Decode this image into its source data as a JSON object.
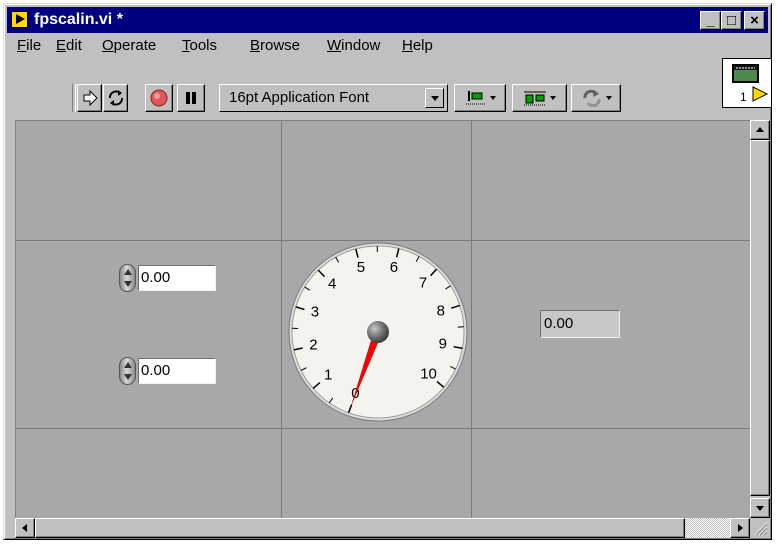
{
  "window": {
    "title": "fpscalin.vi *",
    "controls": {
      "minimize": "_",
      "maximize": "□",
      "close": "×"
    }
  },
  "menu": [
    "File",
    "Edit",
    "Operate",
    "Tools",
    "Browse",
    "Window",
    "Help"
  ],
  "toolbar": {
    "font_selector": "16pt Application Font",
    "icons": [
      "run-arrow-icon",
      "run-continuous-icon",
      "abort-icon",
      "pause-icon",
      "align-objects-icon",
      "distribute-objects-icon",
      "reorder-icon"
    ]
  },
  "vi_icon": {
    "connector_label": "1"
  },
  "panel": {
    "numeric_control_top": {
      "value": "0.00"
    },
    "numeric_control_bottom": {
      "value": "0.00"
    },
    "numeric_indicator": {
      "value": "0.00"
    },
    "gauge": {
      "min": 0,
      "max": 10,
      "value": 0,
      "scale_labels": [
        "0",
        "1",
        "2",
        "3",
        "4",
        "5",
        "6",
        "7",
        "8",
        "9",
        "10"
      ],
      "needle_color": "#ff0000"
    }
  },
  "colors": {
    "titlebar": "#000080",
    "panel": "#a8a8a8",
    "chrome": "#c0c0c0"
  }
}
